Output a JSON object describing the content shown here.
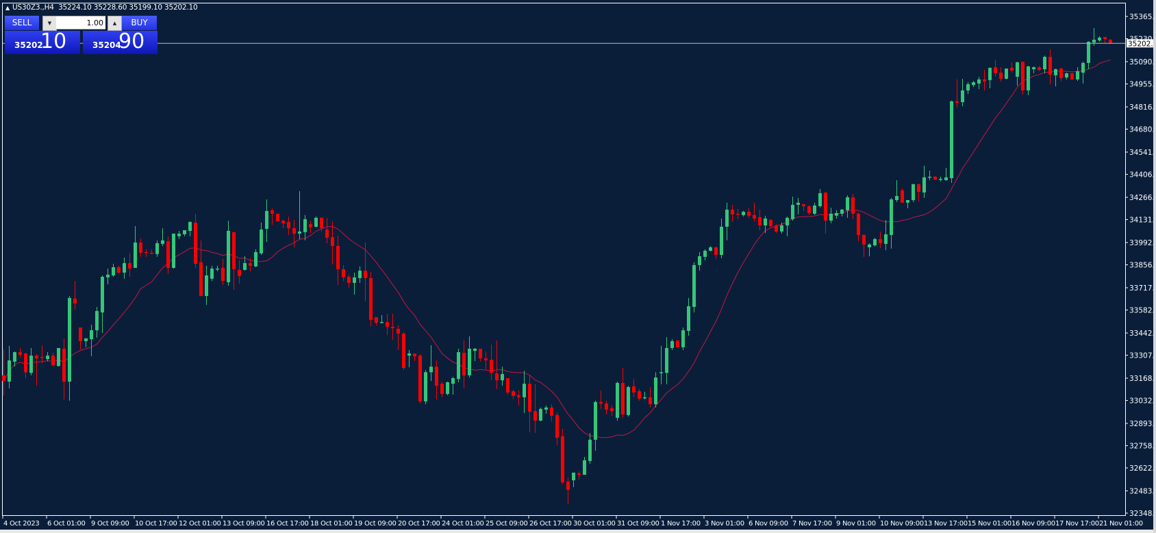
{
  "header": {
    "symbol": "US30Z3.,H4",
    "ohlc": "35224.10 35228.60 35199.10 35202.10"
  },
  "trade_panel": {
    "sell_label": "SELL",
    "buy_label": "BUY",
    "lot": "1.00",
    "sell_price_small": "35202",
    "sell_price_big": "10",
    "buy_price_small": "35204",
    "buy_price_big": "90"
  },
  "colors": {
    "background": "#0a1e3a",
    "bull": "#35c779",
    "bear": "#ff0000",
    "ma": "#c8163e",
    "bid_line": "#b8bcc8"
  },
  "chart_data": {
    "type": "candlestick",
    "timeframe": "H4",
    "ylim": [
      32348.0,
      35365.6
    ],
    "bid": 35202.1,
    "bid_label": "35202.10",
    "price_ticks": [
      "35365.60",
      "35230.30",
      "35090.90",
      "34955.60",
      "34816.20",
      "34680.90",
      "34541.50",
      "34406.20",
      "34266.80",
      "34131.50",
      "33992.10",
      "33856.80",
      "33717.40",
      "33582.10",
      "33442.70",
      "33307.40",
      "33168.00",
      "33032.70",
      "32893.30",
      "32758.00",
      "32622.70",
      "32483.30",
      "32348.00"
    ],
    "time_labels": [
      "4 Oct 2023",
      "6 Oct 01:00",
      "9 Oct 09:00",
      "10 Oct 17:00",
      "12 Oct 01:00",
      "13 Oct 09:00",
      "16 Oct 17:00",
      "18 Oct 01:00",
      "19 Oct 09:00",
      "20 Oct 17:00",
      "24 Oct 01:00",
      "25 Oct 09:00",
      "26 Oct 17:00",
      "30 Oct 01:00",
      "31 Oct 09:00",
      "1 Nov 17:00",
      "3 Nov 01:00",
      "6 Nov 09:00",
      "7 Nov 17:00",
      "9 Nov 01:00",
      "10 Nov 09:00",
      "13 Nov 17:00",
      "15 Nov 01:00",
      "16 Nov 09:00",
      "17 Nov 17:00",
      "21 Nov 01:00"
    ],
    "candles_ohlc": [
      [
        33185,
        33343,
        33064,
        33151
      ],
      [
        33147,
        33364,
        33106,
        33276
      ],
      [
        33268,
        33330,
        33238,
        33326
      ],
      [
        33326,
        33351,
        33292,
        33309
      ],
      [
        33318,
        33322,
        33168,
        33204
      ],
      [
        33200,
        33351,
        33185,
        33305
      ],
      [
        33305,
        33314,
        33122,
        33288
      ],
      [
        33297,
        33368,
        33259,
        33292
      ],
      [
        33284,
        33326,
        33272,
        33305
      ],
      [
        33305,
        33322,
        33238,
        33246
      ],
      [
        33242,
        33351,
        33238,
        33351
      ],
      [
        33347,
        33410,
        33039,
        33147
      ],
      [
        33147,
        33667,
        33031,
        33655
      ],
      [
        33651,
        33759,
        33584,
        33622
      ],
      [
        33476,
        33476,
        33343,
        33393
      ],
      [
        33393,
        33410,
        33356,
        33410
      ],
      [
        33405,
        33493,
        33301,
        33459
      ],
      [
        33459,
        33601,
        33414,
        33576
      ],
      [
        33567,
        33792,
        33443,
        33784
      ],
      [
        33780,
        33834,
        33738,
        33797
      ],
      [
        33792,
        33863,
        33784,
        33842
      ],
      [
        33842,
        33851,
        33801,
        33809
      ],
      [
        33809,
        33901,
        33772,
        33867
      ],
      [
        33867,
        33926,
        33784,
        33834
      ],
      [
        33838,
        34092,
        33838,
        33992
      ],
      [
        33992,
        34017,
        33905,
        33930
      ],
      [
        33934,
        33951,
        33905,
        33930
      ],
      [
        33930,
        33951,
        33922,
        33926
      ],
      [
        33922,
        34005,
        33905,
        33988
      ],
      [
        33984,
        34079,
        33971,
        34005
      ],
      [
        34000,
        34030,
        33801,
        33838
      ],
      [
        33838,
        34046,
        33834,
        34046
      ],
      [
        34030,
        34063,
        34013,
        34046
      ],
      [
        34042,
        34067,
        34030,
        34067
      ],
      [
        34063,
        34121,
        34030,
        34117
      ],
      [
        34113,
        34167,
        33838,
        33863
      ],
      [
        33872,
        34005,
        33667,
        33667
      ],
      [
        33667,
        33851,
        33613,
        33792
      ],
      [
        33772,
        33851,
        33759,
        33834
      ],
      [
        33830,
        33851,
        33817,
        33834
      ],
      [
        33838,
        33893,
        33734,
        33759
      ],
      [
        33751,
        34125,
        33730,
        34063
      ],
      [
        34055,
        34055,
        33705,
        33830
      ],
      [
        33826,
        33884,
        33742,
        33788
      ],
      [
        33826,
        33909,
        33821,
        33867
      ],
      [
        33867,
        33897,
        33817,
        33851
      ],
      [
        33847,
        33951,
        33842,
        33934
      ],
      [
        33926,
        34113,
        33917,
        34071
      ],
      [
        34075,
        34254,
        33996,
        34184
      ],
      [
        34188,
        34200,
        34100,
        34167
      ],
      [
        34167,
        34167,
        34121,
        34121
      ],
      [
        34125,
        34129,
        34079,
        34109
      ],
      [
        34117,
        34150,
        34038,
        34079
      ],
      [
        34079,
        34129,
        33963,
        34046
      ],
      [
        34046,
        34304,
        34013,
        34059
      ],
      [
        34055,
        34159,
        34005,
        34134
      ],
      [
        34104,
        34125,
        34050,
        34084
      ],
      [
        34088,
        34150,
        34084,
        34142
      ],
      [
        34142,
        34146,
        34059,
        34079
      ],
      [
        34071,
        34142,
        33988,
        34021
      ],
      [
        34025,
        34121,
        33859,
        33971
      ],
      [
        33971,
        34034,
        33734,
        33830
      ],
      [
        33830,
        33855,
        33759,
        33780
      ],
      [
        33784,
        33797,
        33717,
        33747
      ],
      [
        33747,
        33809,
        33676,
        33780
      ],
      [
        33776,
        33847,
        33747,
        33821
      ],
      [
        33821,
        33992,
        33634,
        33776
      ],
      [
        33776,
        33813,
        33484,
        33522
      ],
      [
        33538,
        33538,
        33489,
        33505
      ],
      [
        33509,
        33551,
        33501,
        33509
      ],
      [
        33509,
        33559,
        33430,
        33480
      ],
      [
        33480,
        33559,
        33401,
        33472
      ],
      [
        33468,
        33489,
        33339,
        33439
      ],
      [
        33439,
        33447,
        33217,
        33230
      ],
      [
        33305,
        33339,
        33234,
        33318
      ],
      [
        33318,
        33318,
        33272,
        33301
      ],
      [
        33305,
        33314,
        33014,
        33027
      ],
      [
        33027,
        33217,
        33010,
        33204
      ],
      [
        33204,
        33368,
        33151,
        33238
      ],
      [
        33238,
        33276,
        33039,
        33122
      ],
      [
        33134,
        33147,
        33052,
        33072
      ],
      [
        33072,
        33147,
        33064,
        33143
      ],
      [
        33134,
        33176,
        33068,
        33168
      ],
      [
        33163,
        33347,
        33143,
        33326
      ],
      [
        33322,
        33397,
        33106,
        33185
      ],
      [
        33185,
        33422,
        33172,
        33347
      ],
      [
        33334,
        33351,
        33272,
        33347
      ],
      [
        33347,
        33347,
        33268,
        33288
      ],
      [
        33288,
        33330,
        33222,
        33276
      ],
      [
        33280,
        33372,
        33155,
        33200
      ],
      [
        33197,
        33397,
        33102,
        33155
      ],
      [
        33155,
        33238,
        33122,
        33193
      ],
      [
        33168,
        33168,
        33068,
        33081
      ],
      [
        33089,
        33097,
        33039,
        33060
      ],
      [
        33064,
        33093,
        33002,
        33052
      ],
      [
        33052,
        33213,
        32956,
        33134
      ],
      [
        33134,
        33185,
        32839,
        32964
      ],
      [
        32968,
        33131,
        32835,
        32910
      ],
      [
        32910,
        32990,
        32906,
        32981
      ],
      [
        32977,
        33002,
        32952,
        32990
      ],
      [
        32990,
        33010,
        32906,
        32940
      ],
      [
        32944,
        32960,
        32760,
        32806
      ],
      [
        32815,
        32860,
        32523,
        32535
      ],
      [
        32540,
        32565,
        32406,
        32490
      ],
      [
        32548,
        32594,
        32506,
        32594
      ],
      [
        32590,
        32602,
        32552,
        32581
      ],
      [
        32581,
        32690,
        32581,
        32669
      ],
      [
        32665,
        32835,
        32648,
        32794
      ],
      [
        32794,
        33031,
        32727,
        33023
      ],
      [
        33023,
        33093,
        32981,
        33014
      ],
      [
        33014,
        33031,
        32948,
        32977
      ],
      [
        32985,
        33002,
        32940,
        32968
      ],
      [
        32927,
        33147,
        32910,
        33139
      ],
      [
        33139,
        33230,
        32927,
        32948
      ],
      [
        32944,
        33122,
        32935,
        33114
      ],
      [
        33118,
        33163,
        33052,
        33081
      ],
      [
        33089,
        33102,
        33031,
        33043
      ],
      [
        33047,
        33085,
        33039,
        33052
      ],
      [
        33052,
        33114,
        32990,
        33010
      ],
      [
        33010,
        33204,
        32990,
        33172
      ],
      [
        33200,
        33364,
        33131,
        33204
      ],
      [
        33200,
        33418,
        33131,
        33351
      ],
      [
        33351,
        33405,
        33339,
        33393
      ],
      [
        33397,
        33397,
        33351,
        33356
      ],
      [
        33356,
        33476,
        33339,
        33459
      ],
      [
        33455,
        33655,
        33426,
        33605
      ],
      [
        33601,
        33872,
        33567,
        33855
      ],
      [
        33855,
        33934,
        33821,
        33909
      ],
      [
        33905,
        33951,
        33884,
        33942
      ],
      [
        33942,
        33971,
        33938,
        33963
      ],
      [
        33963,
        33967,
        33893,
        33917
      ],
      [
        33917,
        34138,
        33897,
        34088
      ],
      [
        34088,
        34234,
        34005,
        34192
      ],
      [
        34192,
        34221,
        34117,
        34163
      ],
      [
        34167,
        34196,
        34134,
        34163
      ],
      [
        34159,
        34184,
        34150,
        34179
      ],
      [
        34179,
        34200,
        34142,
        34155
      ],
      [
        34159,
        34234,
        34121,
        34138
      ],
      [
        34146,
        34192,
        34067,
        34096
      ],
      [
        34096,
        34155,
        34050,
        34138
      ],
      [
        34129,
        34134,
        34084,
        34092
      ],
      [
        34096,
        34104,
        34050,
        34059
      ],
      [
        34059,
        34113,
        34046,
        34096
      ],
      [
        34096,
        34150,
        34030,
        34142
      ],
      [
        34134,
        34271,
        34125,
        34221
      ],
      [
        34221,
        34263,
        34163,
        34234
      ],
      [
        34225,
        34225,
        34184,
        34213
      ],
      [
        34213,
        34217,
        34159,
        34171
      ],
      [
        34167,
        34234,
        34159,
        34217
      ],
      [
        34213,
        34317,
        34204,
        34292
      ],
      [
        34296,
        34296,
        34046,
        34125
      ],
      [
        34125,
        34204,
        34109,
        34167
      ],
      [
        34155,
        34188,
        34138,
        34171
      ],
      [
        34167,
        34196,
        34150,
        34192
      ],
      [
        34188,
        34279,
        34142,
        34267
      ],
      [
        34267,
        34288,
        34134,
        34167
      ],
      [
        34167,
        34175,
        34000,
        34038
      ],
      [
        34038,
        34042,
        33905,
        33980
      ],
      [
        33963,
        33988,
        33909,
        33980
      ],
      [
        33975,
        34021,
        33967,
        34013
      ],
      [
        34013,
        34059,
        33959,
        33988
      ],
      [
        33984,
        34129,
        33946,
        34042
      ],
      [
        34038,
        34263,
        33955,
        34254
      ],
      [
        34250,
        34371,
        34238,
        34275
      ],
      [
        34309,
        34321,
        34234,
        34234
      ],
      [
        34234,
        34250,
        34200,
        34250
      ],
      [
        34250,
        34350,
        34238,
        34346
      ],
      [
        34346,
        34350,
        34242,
        34300
      ],
      [
        34296,
        34458,
        34263,
        34388
      ],
      [
        34388,
        34429,
        34371,
        34392
      ],
      [
        34392,
        34396,
        34371,
        34375
      ],
      [
        34379,
        34392,
        34363,
        34379
      ],
      [
        34371,
        34446,
        34367,
        34388
      ],
      [
        34383,
        34854,
        34354,
        34850
      ],
      [
        34850,
        34983,
        34812,
        34841
      ],
      [
        34845,
        34987,
        34820,
        34916
      ],
      [
        34916,
        34966,
        34895,
        34954
      ],
      [
        34949,
        34974,
        34937,
        34966
      ],
      [
        34958,
        34999,
        34924,
        34983
      ],
      [
        34983,
        35041,
        34916,
        34970
      ],
      [
        34979,
        35057,
        34929,
        35053
      ],
      [
        35057,
        35103,
        34999,
        35020
      ],
      [
        35024,
        35057,
        34970,
        34987
      ],
      [
        34987,
        35049,
        34983,
        35049
      ],
      [
        35053,
        35087,
        35024,
        35037
      ],
      [
        34999,
        35091,
        34945,
        35087
      ],
      [
        35091,
        35091,
        34891,
        34916
      ],
      [
        34916,
        35066,
        34887,
        35062
      ],
      [
        35045,
        35062,
        35020,
        35057
      ],
      [
        35057,
        35066,
        35033,
        35041
      ],
      [
        35045,
        35128,
        35020,
        35120
      ],
      [
        35120,
        35166,
        34954,
        35012
      ],
      [
        35008,
        35049,
        34941,
        35045
      ],
      [
        35049,
        35053,
        34970,
        34991
      ],
      [
        34995,
        35024,
        34983,
        35020
      ],
      [
        35020,
        35024,
        34979,
        34983
      ],
      [
        34983,
        35057,
        34974,
        35033
      ],
      [
        35024,
        35091,
        34958,
        35083
      ],
      [
        35083,
        35216,
        35045,
        35212
      ],
      [
        35207,
        35295,
        35187,
        35224
      ],
      [
        35220,
        35245,
        35212,
        35237
      ],
      [
        35241,
        35241,
        35203,
        35228
      ],
      [
        35224.1,
        35228.6,
        35199.1,
        35202.1
      ]
    ]
  }
}
